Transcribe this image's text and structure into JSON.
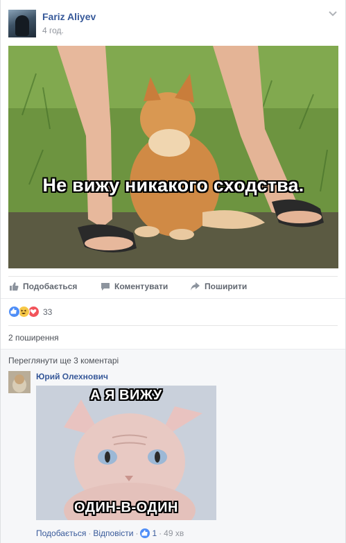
{
  "post": {
    "author": "Fariz Aliyev",
    "time": "4 год.",
    "caption": "Не вижу никакого сходства."
  },
  "actions": {
    "like": "Подобається",
    "comment": "Коментувати",
    "share": "Поширити"
  },
  "reactions": {
    "count": "33",
    "icons": [
      "like-icon",
      "haha-icon",
      "love-icon"
    ]
  },
  "shares": "2 поширення",
  "comments": {
    "view_more": "Переглянути ще 3 коментарі",
    "items": [
      {
        "author": "Юрий Олехнович",
        "image_top_text": "А Я ВИЖУ",
        "image_bottom_text": "ОДИН-В-ОДИН",
        "like_label": "Подобається",
        "reply_label": "Відповісти",
        "like_count": "1",
        "time": "49 хв"
      }
    ]
  },
  "colors": {
    "link": "#365899",
    "like_blue": "#4f8ef7",
    "love_red": "#f2545b",
    "haha_yellow": "#f7c847"
  }
}
